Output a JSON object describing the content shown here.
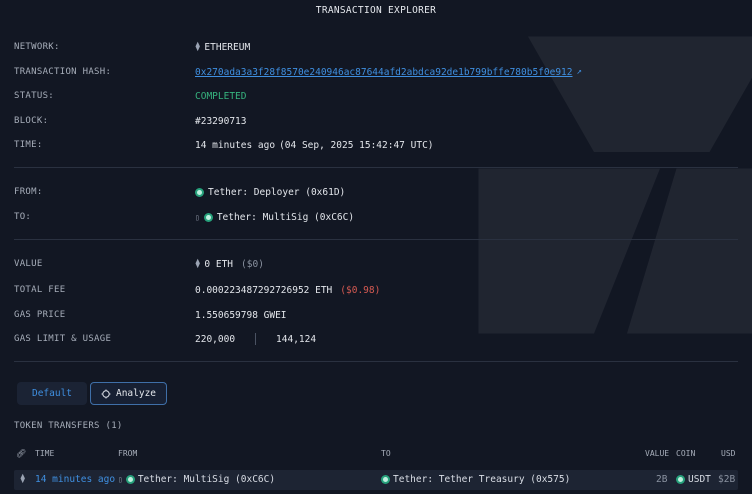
{
  "header": {
    "title": "TRANSACTION EXPLORER"
  },
  "details": {
    "network_label": "NETWORK:",
    "network_value": "ETHEREUM",
    "hash_label": "TRANSACTION HASH:",
    "hash_value": "0x270ada3a3f28f8570e240946ac87644afd2abdca92de1b799bffe780b5f0e912",
    "status_label": "STATUS:",
    "status_value": "COMPLETED",
    "block_label": "BLOCK:",
    "block_value": "#23290713",
    "time_label": "TIME:",
    "time_value": "14 minutes ago",
    "time_exact": "(04 Sep, 2025 15:42:47 UTC)",
    "from_label": "FROM:",
    "from_value": "Tether: Deployer (0x61D)",
    "to_label": "TO:",
    "to_value": "Tether: MultiSig (0xC6C)",
    "value_label": "VALUE",
    "value_value": "0 ETH",
    "value_usd": "($0)",
    "fee_label": "TOTAL FEE",
    "fee_value": "0.000223487292726952 ETH",
    "fee_usd": "($0.98)",
    "gas_price_label": "GAS PRICE",
    "gas_price_value": "1.550659798 GWEI",
    "gas_limit_label": "GAS LIMIT & USAGE",
    "gas_limit_value": "220,000",
    "gas_usage_value": "144,124"
  },
  "buttons": {
    "default_label": "Default",
    "analyze_label": "Analyze"
  },
  "token_transfers": {
    "title": "TOKEN TRANSFERS (1)",
    "columns": {
      "time": "TIME",
      "from": "FROM",
      "to": "TO",
      "value": "VALUE",
      "coin": "COIN",
      "usd": "USD"
    },
    "rows": [
      {
        "time": "14 minutes ago",
        "from": "Tether: MultiSig (0xC6C)",
        "to": "Tether: Tether Treasury (0x575)",
        "value": "2B",
        "coin": "USDT",
        "usd": "$2B"
      }
    ]
  },
  "colors": {
    "background": "#121723",
    "link": "#3f8fe0",
    "status": "#36b37e",
    "fee_usd": "#d65a52",
    "tether": "#26a17b"
  },
  "icons": [
    "ethereum-icon",
    "external-link-icon",
    "tether-icon",
    "document-icon",
    "link-icon",
    "analyze-icon"
  ]
}
